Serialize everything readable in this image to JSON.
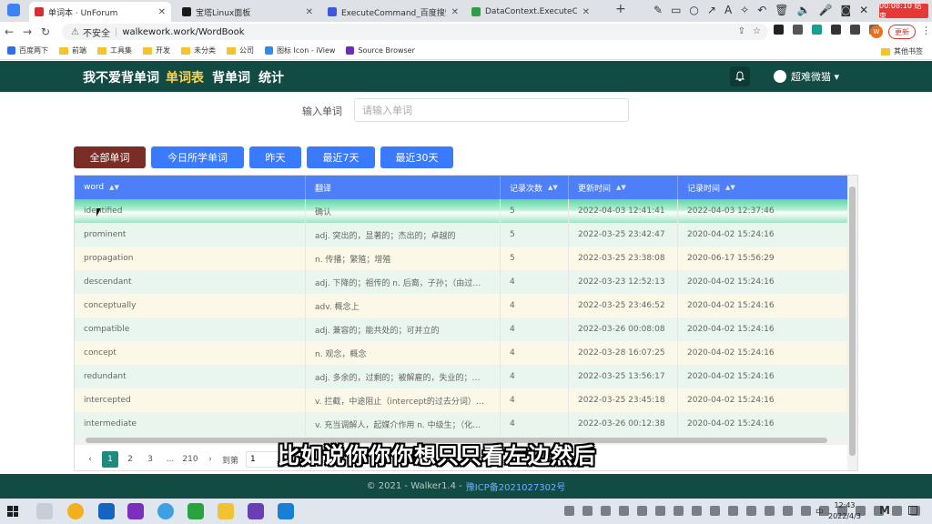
{
  "browser": {
    "tabs": [
      {
        "title": "单词本 · UnForum",
        "color": "#d32f2f",
        "active": true
      },
      {
        "title": "宝塔Linux面板",
        "color": "#1a1a1a",
        "active": false
      },
      {
        "title": "ExecuteCommand_百度搜索",
        "color": "#3b5bdb",
        "active": false
      },
      {
        "title": "DataContext.ExecuteComman",
        "color": "#2e9e45",
        "active": false
      }
    ],
    "new_tab": "+",
    "recording_time": "00:08:10 结束",
    "security_label": "不安全",
    "url": "walkework.work/WordBook",
    "update_label": "更新",
    "avatar_letter": "W",
    "bookmarks": [
      "百度两下",
      "前端",
      "工具集",
      "开发",
      "未分类",
      "公司",
      "图标 Icon - iView",
      "Source Browser"
    ],
    "other_bookmarks": "其他书签"
  },
  "header": {
    "nav": [
      {
        "label": "我不爱背单词",
        "active": false
      },
      {
        "label": "单词表",
        "active": true
      },
      {
        "label": "背单词",
        "active": false
      },
      {
        "label": "统计",
        "active": false
      }
    ],
    "bell_icon": "bell-icon",
    "user_name": "超难微猫 ▾"
  },
  "search": {
    "label": "输入单词",
    "placeholder": "请输入单词",
    "value": ""
  },
  "filters": [
    {
      "label": "全部单词",
      "style": "dark"
    },
    {
      "label": "今日所学单词",
      "style": "primary"
    },
    {
      "label": "昨天",
      "style": "primary"
    },
    {
      "label": "最近7天",
      "style": "primary"
    },
    {
      "label": "最近30天",
      "style": "primary"
    }
  ],
  "table": {
    "columns": [
      "word",
      "翻译",
      "记录次数",
      "更新时间",
      "记录时间"
    ],
    "rows": [
      {
        "word": "identified",
        "translation": "确认",
        "count": "5",
        "updated": "2022-04-03 12:41:41",
        "recorded": "2022-04-03 12:37:46",
        "selected": true
      },
      {
        "word": "prominent",
        "translation": "adj. 突出的，显著的；杰出的；卓越的",
        "count": "5",
        "updated": "2022-03-25 23:42:47",
        "recorded": "2020-04-02 15:24:16"
      },
      {
        "word": "propagation",
        "translation": "n. 传播；繁殖；增殖",
        "count": "5",
        "updated": "2022-03-25 23:38:08",
        "recorded": "2020-06-17 15:56:29"
      },
      {
        "word": "descendant",
        "translation": "adj. 下降的；祖传的 n. 后裔，子孙；（由过…",
        "count": "4",
        "updated": "2022-03-23 12:52:13",
        "recorded": "2020-04-02 15:24:16"
      },
      {
        "word": "conceptually",
        "translation": "adv. 概念上",
        "count": "4",
        "updated": "2022-03-25 23:46:52",
        "recorded": "2020-04-02 15:24:16"
      },
      {
        "word": "compatible",
        "translation": "adj. 兼容的；能共处的；可并立的",
        "count": "4",
        "updated": "2022-03-26 00:08:08",
        "recorded": "2020-04-02 15:24:16"
      },
      {
        "word": "concept",
        "translation": "n. 观念，概念",
        "count": "4",
        "updated": "2022-03-28 16:07:25",
        "recorded": "2020-04-02 15:24:16"
      },
      {
        "word": "redundant",
        "translation": "adj. 多余的，过剩的；被解雇的，失业的；…",
        "count": "4",
        "updated": "2022-03-25 13:56:17",
        "recorded": "2020-04-02 15:24:16"
      },
      {
        "word": "intercepted",
        "translation": "v. 拦截，中途阻止（intercept的过去分词）…",
        "count": "4",
        "updated": "2022-03-25 23:45:18",
        "recorded": "2020-04-02 15:24:16"
      },
      {
        "word": "intermediate",
        "translation": "v. 充当调解人，起媒介作用 n. 中级生；（化…",
        "count": "4",
        "updated": "2022-03-26 00:12:38",
        "recorded": "2020-04-02 15:24:16"
      }
    ]
  },
  "pagination": {
    "prev": "‹",
    "pages": [
      "1",
      "2",
      "3",
      "...",
      "210"
    ],
    "current": "1",
    "next": "›",
    "goto_label": "到第",
    "goto_value": "1"
  },
  "subtitle": "比如说你你你想只只看左边然后",
  "footer": {
    "copyright": "© 2021 - Walker1.4 -",
    "icp": "豫ICP备2021027302号"
  },
  "taskbar": {
    "time": "12:43",
    "date": "2022/4/3",
    "ime": "中"
  }
}
